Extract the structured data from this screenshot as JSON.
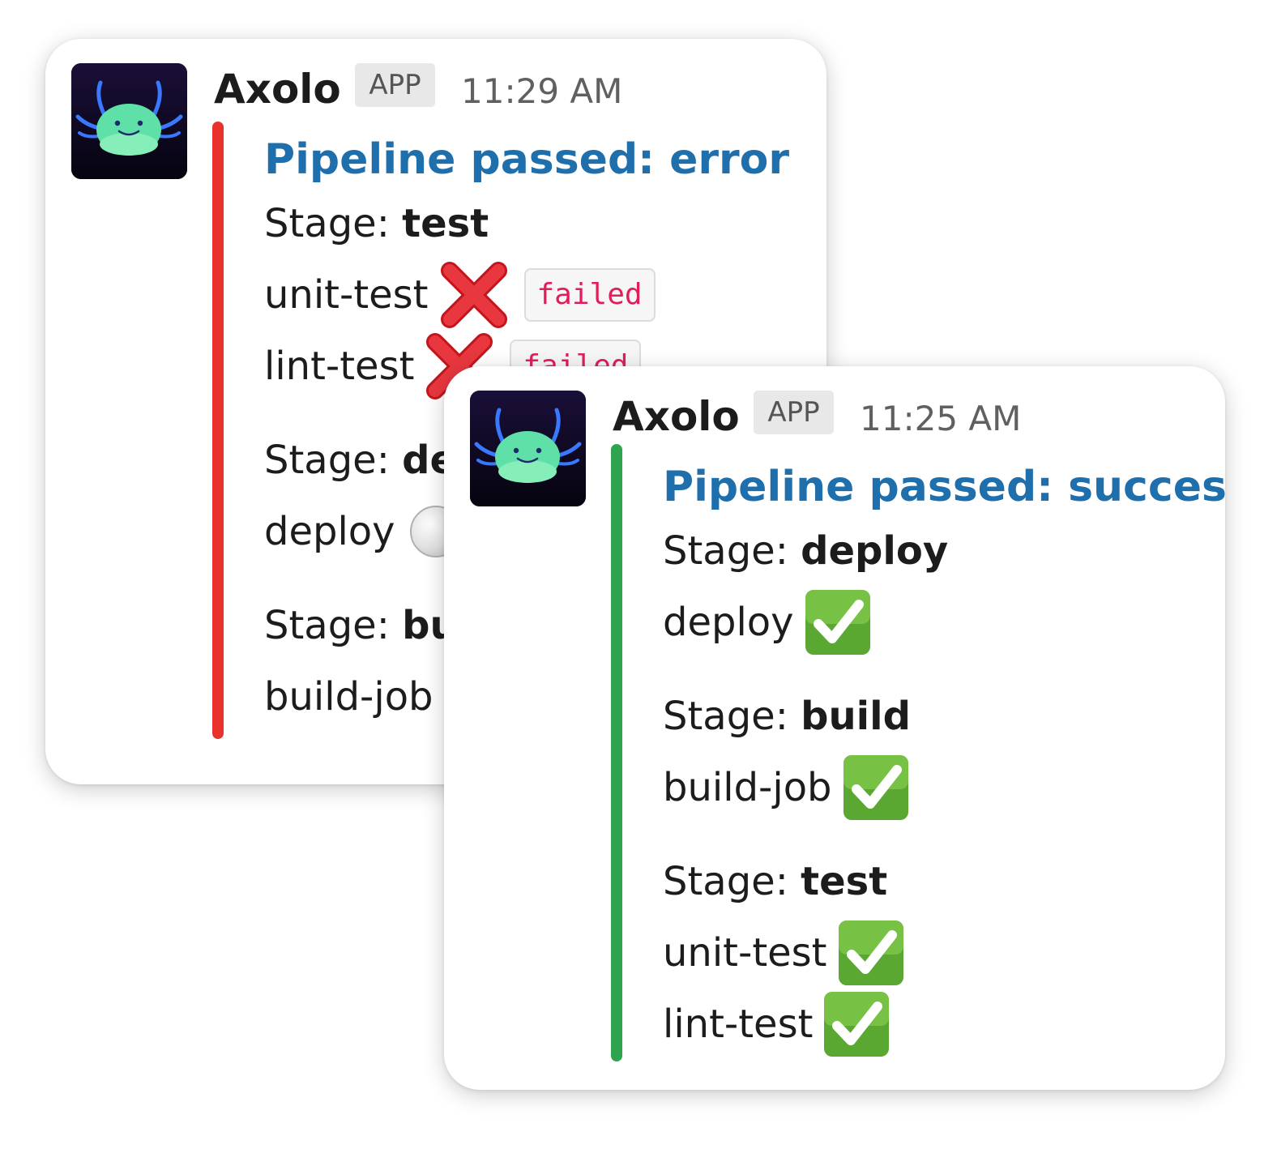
{
  "colors": {
    "error_bar": "#e8322b",
    "success_bar": "#2ea44f",
    "title_link": "#1e6fab",
    "code_text": "#e01e5a"
  },
  "messages": [
    {
      "sender": "Axolo",
      "badge": "APP",
      "time": "11:29 AM",
      "title": "Pipeline passed: error",
      "stages": [
        {
          "prefix": "Stage: ",
          "name": "test",
          "jobs": [
            {
              "name": "unit-test",
              "status_icon": "cross-mark-icon",
              "status_label": "failed"
            },
            {
              "name": "lint-test",
              "status_icon": "cross-mark-icon",
              "status_label": "failed"
            }
          ]
        },
        {
          "prefix": "Stage: ",
          "name": "deploy",
          "jobs": [
            {
              "name": "deploy",
              "status_icon": "pending-circle-icon"
            }
          ]
        },
        {
          "prefix": "Stage: ",
          "name": "build",
          "jobs": [
            {
              "name": "build-job"
            }
          ]
        }
      ]
    },
    {
      "sender": "Axolo",
      "badge": "APP",
      "time": "11:25 AM",
      "title": "Pipeline passed: success",
      "stages": [
        {
          "prefix": "Stage: ",
          "name": "deploy",
          "jobs": [
            {
              "name": "deploy",
              "status_icon": "check-mark-icon"
            }
          ]
        },
        {
          "prefix": "Stage: ",
          "name": "build",
          "jobs": [
            {
              "name": "build-job",
              "status_icon": "check-mark-icon"
            }
          ]
        },
        {
          "prefix": "Stage: ",
          "name": "test",
          "jobs": [
            {
              "name": "unit-test",
              "status_icon": "check-mark-icon"
            },
            {
              "name": "lint-test",
              "status_icon": "check-mark-icon"
            }
          ]
        }
      ]
    }
  ]
}
